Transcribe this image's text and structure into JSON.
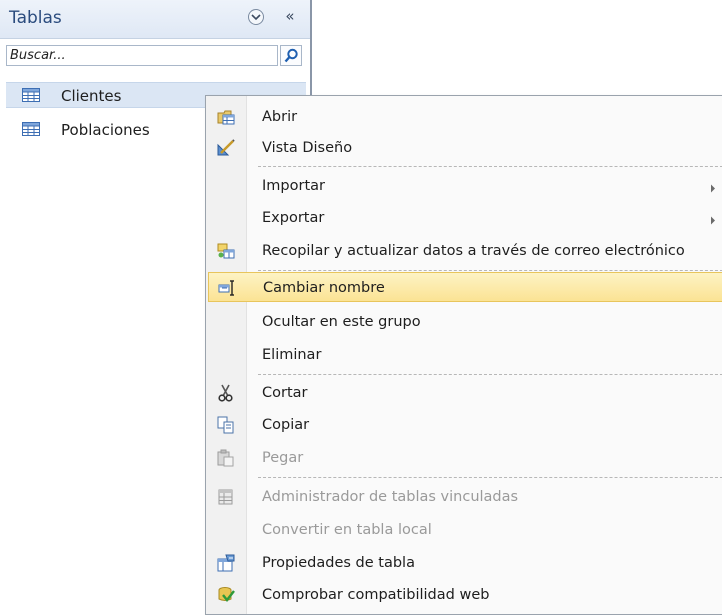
{
  "nav_pane": {
    "title": "Tablas",
    "search_placeholder": "Buscar...",
    "items": [
      {
        "label": "Clientes"
      },
      {
        "label": "Poblaciones"
      }
    ]
  },
  "context_menu": {
    "items": [
      {
        "label": "Abrir",
        "icon": "open-table-icon"
      },
      {
        "label": "Vista Diseño",
        "icon": "design-view-icon"
      },
      {
        "label": "Importar",
        "submenu": true
      },
      {
        "label": "Exportar",
        "submenu": true
      },
      {
        "label": "Recopilar y actualizar datos a través de correo electrónico",
        "icon": "collect-data-icon"
      },
      {
        "label": "Cambiar nombre",
        "icon": "rename-icon",
        "highlighted": true
      },
      {
        "label": "Ocultar en este grupo"
      },
      {
        "label": "Eliminar"
      },
      {
        "label": "Cortar",
        "icon": "scissors-icon"
      },
      {
        "label": "Copiar",
        "icon": "copy-icon"
      },
      {
        "label": "Pegar",
        "icon": "paste-icon",
        "disabled": true
      },
      {
        "label": "Administrador de tablas vinculadas",
        "icon": "linked-tables-icon",
        "disabled": true
      },
      {
        "label": "Convertir en tabla local",
        "disabled": true
      },
      {
        "label": "Propiedades de tabla",
        "icon": "properties-icon"
      },
      {
        "label": "Comprobar compatibilidad web",
        "icon": "web-check-icon"
      }
    ]
  },
  "colors": {
    "highlight": "#fbe394",
    "nav_title": "#2b4c7e",
    "disabled_text": "#9a9a9a"
  }
}
